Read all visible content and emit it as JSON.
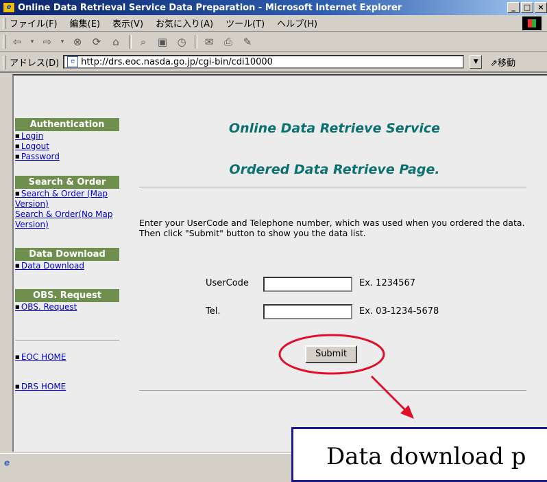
{
  "window": {
    "title": "Online Data Retrieval Service Data Preparation - Microsoft Internet Explorer",
    "buttons": [
      "_",
      "□",
      "×"
    ]
  },
  "menubar": {
    "items": [
      "ファイル(F)",
      "編集(E)",
      "表示(V)",
      "お気に入り(A)",
      "ツール(T)",
      "ヘルプ(H)"
    ]
  },
  "addressbar": {
    "label": "アドレス(D)",
    "url": "http://drs.eoc.nasda.go.jp/cgi-bin/cdi10000",
    "go_label": "移動"
  },
  "sidebar": {
    "auth": {
      "heading": "Authentication",
      "links": [
        "Login",
        "Logout",
        "Password"
      ]
    },
    "search": {
      "heading": "Search & Order",
      "link1": "Search & Order (Map Version)",
      "link2": "Search & Order(No Map Version)"
    },
    "download": {
      "heading": "Data Download",
      "link": "Data Download"
    },
    "obs": {
      "heading": "OBS. Request",
      "link": "OBS. Request"
    },
    "eoc_home": "EOC HOME",
    "drs_home": "DRS HOME"
  },
  "main": {
    "title1": "Online Data Retrieve Service",
    "title2": "Ordered Data Retrieve Page.",
    "instruction1": "Enter your UserCode and Telephone number, which was used when you ordered the data.",
    "instruction2": "Then click \"Submit\" button to show you the data list.",
    "usercode_label": "UserCode",
    "usercode_value": "",
    "usercode_example": "Ex. 1234567",
    "tel_label": "Tel.",
    "tel_value": "",
    "tel_example": "Ex. 03-1234-5678",
    "submit_label": "Submit"
  },
  "annotation": {
    "callout_text": "Data download p",
    "highlight_color": "#e0102a",
    "arrow_color": "#e0102a"
  },
  "colors": {
    "sidebar_heading": "#6f8f4f",
    "title_teal": "#0a7070",
    "link": "#0000cc"
  }
}
